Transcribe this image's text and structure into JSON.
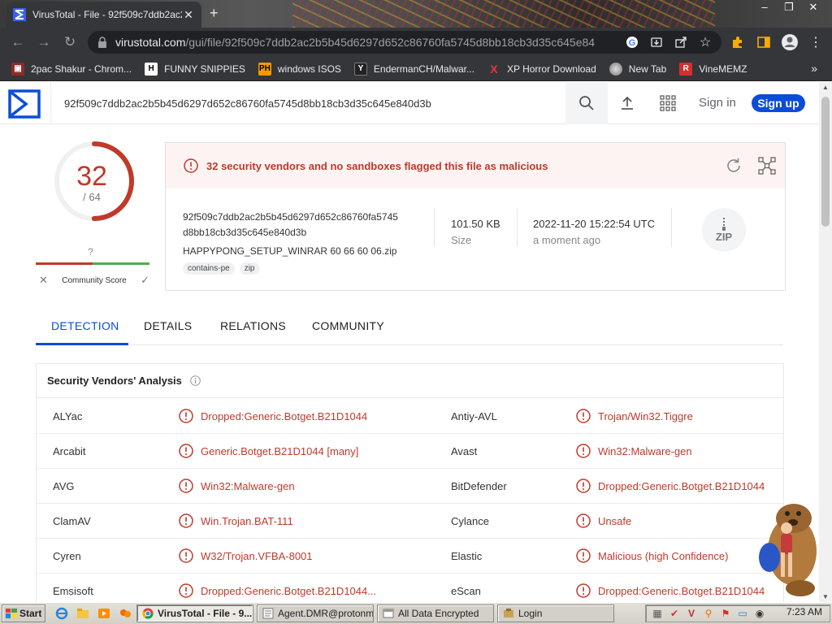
{
  "browser": {
    "tab_title": "VirusTotal - File - 92f509c7ddb2ac2",
    "url_domain": "virustotal.com",
    "url_path": "/gui/file/92f509c7ddb2ac2b5b45d6297d652c86760fa5745d8bb18cb3d35c645e840..."
  },
  "bookmarks": [
    {
      "label": "2pac Shakur - Chrom...",
      "icon": "2pac-icon"
    },
    {
      "label": "FUNNY SNIPPIES",
      "icon": "H"
    },
    {
      "label": "windows ISOS",
      "icon": "PH"
    },
    {
      "label": "EndermanCH/Malwar...",
      "icon": "Y"
    },
    {
      "label": "XP Horror Download",
      "icon": "X"
    },
    {
      "label": "New Tab",
      "icon": "new-tab-icon"
    },
    {
      "label": "VineMEMZ",
      "icon": "R"
    }
  ],
  "vt": {
    "search_value": "92f509c7ddb2ac2b5b45d6297d652c86760fa5745d8bb18cb3d35c645e840d3b",
    "sign_in": "Sign in",
    "sign_up": "Sign up",
    "score": "32",
    "score_total": "/ 64",
    "detection_ratio": 0.5,
    "community_score_value": "?",
    "community_score_label": "Community Score",
    "alert": "32 security vendors and no sandboxes flagged this file as malicious",
    "hash_line1": "92f509c7ddb2ac2b5b45d6297d652c86760fa5745",
    "hash_line2": "d8bb18cb3d35c645e840d3b",
    "file_name": "HAPPYPONG_SETUP_WINRAR 60 66 60 06.zip",
    "tags": [
      "contains-pe",
      "zip"
    ],
    "size_value": "101.50 KB",
    "size_label": "Size",
    "date_value": "2022-11-20 15:22:54 UTC",
    "date_label": "a moment ago",
    "file_type": "ZIP",
    "tabs": [
      "DETECTION",
      "DETAILS",
      "RELATIONS",
      "COMMUNITY"
    ],
    "vendors_title": "Security Vendors' Analysis",
    "vendors": [
      {
        "name1": "ALYac",
        "res1": "Dropped:Generic.Botget.B21D1044",
        "name2": "Antiy-AVL",
        "res2": "Trojan/Win32.Tiggre"
      },
      {
        "name1": "Arcabit",
        "res1": "Generic.Botget.B21D1044 [many]",
        "name2": "Avast",
        "res2": "Win32:Malware-gen"
      },
      {
        "name1": "AVG",
        "res1": "Win32:Malware-gen",
        "name2": "BitDefender",
        "res2": "Dropped:Generic.Botget.B21D1044"
      },
      {
        "name1": "ClamAV",
        "res1": "Win.Trojan.BAT-111",
        "name2": "Cylance",
        "res2": "Unsafe"
      },
      {
        "name1": "Cyren",
        "res1": "W32/Trojan.VFBA-8001",
        "name2": "Elastic",
        "res2": "Malicious (high Confidence)"
      },
      {
        "name1": "Emsisoft",
        "res1": "Dropped:Generic.Botget.B21D1044...",
        "name2": "eScan",
        "res2": "Dropped:Generic.Botget.B21D1044"
      }
    ]
  },
  "taskbar": {
    "start": "Start",
    "buttons": [
      {
        "label": "VirusTotal - File - 9...",
        "active": true
      },
      {
        "label": "Agent.DMR@protonm...",
        "active": false
      },
      {
        "label": "All Data Encrypted",
        "active": false
      },
      {
        "label": "Login",
        "active": false
      }
    ],
    "clock": "7:23 AM"
  },
  "colors": {
    "malicious_red": "#c0392b",
    "vt_blue": "#0b4dda",
    "chrome_dark": "#35363a"
  }
}
